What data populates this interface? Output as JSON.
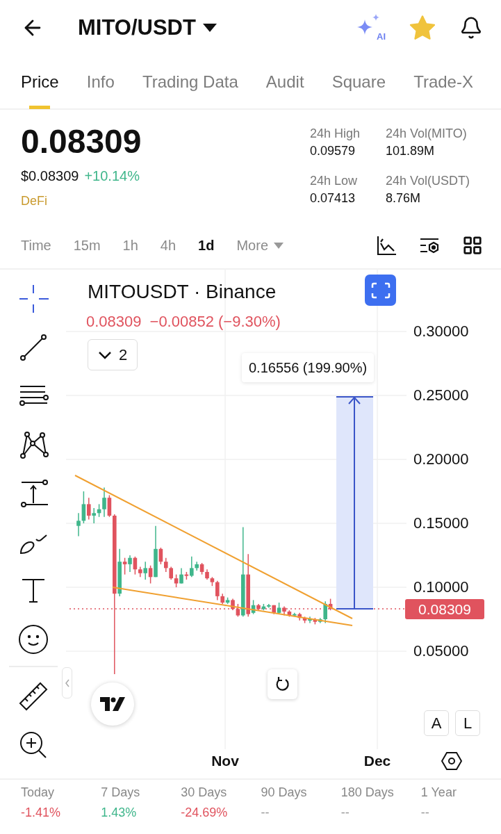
{
  "header": {
    "title": "MITO/USDT",
    "ai_label": "AI",
    "favorite": true
  },
  "tabs": [
    {
      "label": "Price",
      "selected": true
    },
    {
      "label": "Info",
      "selected": false
    },
    {
      "label": "Trading Data",
      "selected": false
    },
    {
      "label": "Audit",
      "selected": false
    },
    {
      "label": "Square",
      "selected": false
    },
    {
      "label": "Trade-X",
      "selected": false
    }
  ],
  "price": {
    "last": "0.08309",
    "usd": "$0.08309",
    "change": "+10.14%",
    "tag": "DeFi"
  },
  "stats": [
    {
      "label": "24h High",
      "value": "0.09579"
    },
    {
      "label": "24h Vol(MITO)",
      "value": "101.89M"
    },
    {
      "label": "24h Low",
      "value": "0.07413"
    },
    {
      "label": "24h Vol(USDT)",
      "value": "8.76M"
    }
  ],
  "intervals": [
    {
      "label": "Time",
      "selected": false
    },
    {
      "label": "15m",
      "selected": false
    },
    {
      "label": "1h",
      "selected": false
    },
    {
      "label": "4h",
      "selected": false
    },
    {
      "label": "1d",
      "selected": true
    }
  ],
  "more_label": "More",
  "drawing_tools": [
    {
      "kind": "crosshair",
      "selected": true
    },
    {
      "kind": "trend_line",
      "selected": false
    },
    {
      "kind": "parallel_lines",
      "selected": false
    },
    {
      "kind": "pattern",
      "selected": false
    },
    {
      "kind": "projection",
      "selected": false
    },
    {
      "kind": "brush",
      "selected": false
    },
    {
      "kind": "text",
      "selected": false
    },
    {
      "kind": "emoji",
      "selected": false
    }
  ],
  "utility_tools": [
    {
      "kind": "ruler",
      "selected": false
    },
    {
      "kind": "zoom",
      "selected": false
    }
  ],
  "chart": {
    "symbol": "MITOUSDT · Binance",
    "last": "0.08309",
    "change": "−0.00852 (−9.30%)",
    "indicator_count": "2",
    "measure_label": "0.16556 (199.90%)",
    "y_labels": [
      "0.30000",
      "0.25000",
      "0.20000",
      "0.15000",
      "0.10000",
      "0.05000"
    ],
    "price_tag": "0.08309",
    "x_labels": [
      "Nov",
      "Dec"
    ],
    "scale_buttons": [
      "A",
      "L"
    ]
  },
  "periods": [
    {
      "label": "Today",
      "value": "-1.41%",
      "color": "#e0535e"
    },
    {
      "label": "7 Days",
      "value": "1.43%",
      "color": "#3fb68b"
    },
    {
      "label": "30 Days",
      "value": "-24.69%",
      "color": "#e0535e"
    },
    {
      "label": "90 Days",
      "value": "--",
      "color": "#999999"
    },
    {
      "label": "180 Days",
      "value": "--",
      "color": "#999999"
    },
    {
      "label": "1 Year",
      "value": "--",
      "color": "#999999"
    }
  ]
}
